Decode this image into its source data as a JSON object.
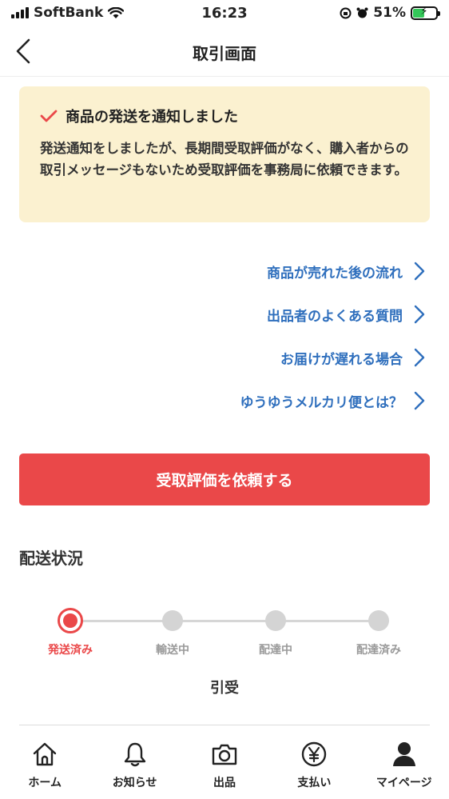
{
  "status_bar": {
    "carrier": "SoftBank",
    "time": "16:23",
    "battery": "51%"
  },
  "nav": {
    "title": "取引画面"
  },
  "notice": {
    "heading": "商品の発送を通知しました",
    "body": "発送通知をしましたが、長期間受取評価がなく、購入者からの取引メッセージもないため受取評価を事務局に依頼できます。"
  },
  "links": [
    {
      "label": "商品が売れた後の流れ"
    },
    {
      "label": "出品者のよくある質問"
    },
    {
      "label": "お届けが遅れる場合"
    },
    {
      "label": "ゆうゆうメルカリ便とは？"
    }
  ],
  "primary_button": {
    "label": "受取評価を依頼する"
  },
  "shipping": {
    "title": "配送状況",
    "steps": [
      {
        "label": "発送済み",
        "active": true
      },
      {
        "label": "輸送中",
        "active": false
      },
      {
        "label": "配達中",
        "active": false
      },
      {
        "label": "配達済み",
        "active": false
      }
    ],
    "detail": "引受"
  },
  "tabbar": {
    "items": [
      {
        "label": "ホーム",
        "icon": "home-icon"
      },
      {
        "label": "お知らせ",
        "icon": "bell-icon"
      },
      {
        "label": "出品",
        "icon": "camera-icon"
      },
      {
        "label": "支払い",
        "icon": "yen-icon"
      },
      {
        "label": "マイページ",
        "icon": "person-icon"
      }
    ]
  },
  "colors": {
    "accent": "#ea4849",
    "link": "#2f6fbd",
    "notice_bg": "#fbf1d0",
    "battery": "#34c759"
  }
}
